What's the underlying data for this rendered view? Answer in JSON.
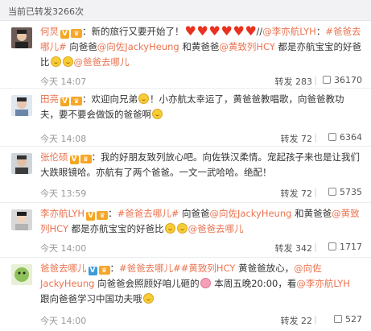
{
  "header": {
    "title": "当前已转发3266次"
  },
  "comments": [
    {
      "user": "何炅",
      "text1": "：新的旅行又要开始了！",
      "text2": "//",
      "mention1": "@李亦航LYH",
      "text3": "：",
      "topic": "#爸爸去哪儿#",
      "text4": " 向爸爸",
      "mention2": "@向佐JackyHeung",
      "text5": " 和黄爸爸",
      "mention3": "@黄致列HCY",
      "text6": " 都是亦航宝宝的好爸比",
      "mention4": "@爸爸去哪儿",
      "time": "今天 14:07",
      "forward": "转发 283",
      "likes": "36170"
    },
    {
      "user": "田亮",
      "text1": "：欢迎向兄弟",
      "text2": "！小亦航太幸运了，黄爸爸教唱歌，向爸爸教功夫，要不要会做饭的爸爸啊",
      "time": "今天 14:08",
      "forward": "转发 72",
      "likes": "6364"
    },
    {
      "user": "张伦硕",
      "text1": "：我的好朋友致列放心吧。向佐铁汉柔情。宠起孩子来也是让我们大跌眼镜哈。亦航有了两个爸爸。一文一武哈哈。绝配！",
      "time": "今天 13:59",
      "forward": "转发 72",
      "likes": "5735"
    },
    {
      "user": "李亦航LYH",
      "text1": "：",
      "topic": "#爸爸去哪儿#",
      "text2": " 向爸爸",
      "mention1": "@向佐JackyHeung",
      "text3": " 和黄爸爸",
      "mention2": "@黄致列HCY",
      "text4": " 都是亦航宝宝的好爸比",
      "mention3": "@爸爸去哪儿",
      "time": "今天 14:00",
      "forward": "转发 342",
      "likes": "1717"
    },
    {
      "user": "爸爸去哪儿",
      "text1": "：",
      "topic": "#爸爸去哪儿#",
      "topic2": "#黄致列HCY",
      "text2": " 黄爸爸放心，",
      "mention1": "@向佐JackyHeung",
      "text3": " 向爸爸会照顾好咱儿砸的",
      "text4": " 本周五晚20:00，看",
      "mention2": "@李亦航LYH",
      "text5": " 跟向爸爸学习中国功夫哦",
      "time": "今天 14:00",
      "forward": "转发 22",
      "likes": "527"
    }
  ]
}
